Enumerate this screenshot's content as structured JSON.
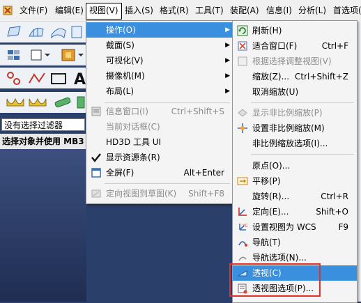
{
  "menubar": {
    "items": [
      "文件(F)",
      "编辑(E)",
      "视图(V)",
      "插入(S)",
      "格式(R)",
      "工具(T)",
      "装配(A)",
      "信息(I)",
      "分析(L)",
      "首选项("
    ]
  },
  "left": {
    "filter_value": "没有选择过滤器",
    "select_text": "选择对象并使用 MB3"
  },
  "view_menu": {
    "items": [
      {
        "label": "操作(O)",
        "shortcut": "",
        "arrow": true
      },
      {
        "label": "截面(S)",
        "shortcut": "",
        "arrow": true
      },
      {
        "label": "可视化(V)",
        "shortcut": "",
        "arrow": true
      },
      {
        "label": "摄像机(M)",
        "shortcut": "",
        "arrow": true
      },
      {
        "label": "布局(L)",
        "shortcut": "",
        "arrow": true
      },
      {
        "label": "信息窗口(I)",
        "shortcut": "Ctrl+Shift+S"
      },
      {
        "label": "当前对话框(C)",
        "shortcut": ""
      },
      {
        "label": "HD3D 工具 UI",
        "shortcut": ""
      },
      {
        "label": "显示资源条(R)",
        "shortcut": ""
      },
      {
        "label": "全屏(F)",
        "shortcut": "Alt+Enter"
      },
      {
        "label": "定向视图到草图(K)",
        "shortcut": "Shift+F8"
      }
    ]
  },
  "sub_menu": {
    "items": [
      {
        "label": "刷新(H)",
        "shortcut": ""
      },
      {
        "label": "适合窗口(F)",
        "shortcut": "Ctrl+F"
      },
      {
        "label": "根据选择调整视图(V)",
        "shortcut": ""
      },
      {
        "label": "缩放(Z)...",
        "shortcut": "Ctrl+Shift+Z"
      },
      {
        "label": "取消缩放(U)",
        "shortcut": ""
      },
      {
        "label": "显示非比例缩放(P)",
        "shortcut": ""
      },
      {
        "label": "设置非比例缩放(M)",
        "shortcut": ""
      },
      {
        "label": "非比例缩放选项(I)...",
        "shortcut": ""
      },
      {
        "label": "原点(O)...",
        "shortcut": ""
      },
      {
        "label": "平移(P)",
        "shortcut": ""
      },
      {
        "label": "旋转(R)...",
        "shortcut": "Ctrl+R"
      },
      {
        "label": "定向(E)...",
        "shortcut": "Shift+O"
      },
      {
        "label": "设置视图为 WCS",
        "shortcut": "F9"
      },
      {
        "label": "导航(T)",
        "shortcut": ""
      },
      {
        "label": "导航选项(N)...",
        "shortcut": ""
      },
      {
        "label": "透视(C)",
        "shortcut": ""
      },
      {
        "label": "透视图选项(P)...",
        "shortcut": ""
      }
    ]
  }
}
